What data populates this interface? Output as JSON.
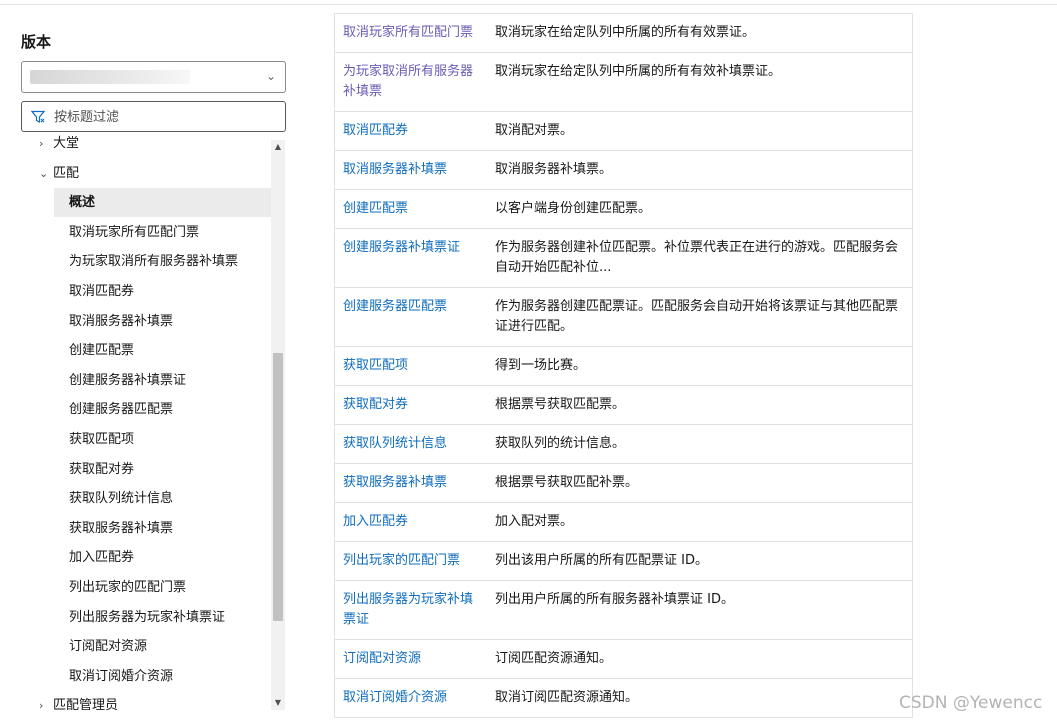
{
  "sidebar": {
    "version_heading": "版本",
    "filter_placeholder": "按标题过滤",
    "tree": [
      {
        "label": "大堂",
        "twisty": "›",
        "level": "parent",
        "selected": false
      },
      {
        "label": "匹配",
        "twisty": "⌄",
        "level": "parent",
        "selected": false
      },
      {
        "label": "概述",
        "twisty": "",
        "level": "child",
        "selected": true
      },
      {
        "label": "取消玩家所有匹配门票",
        "twisty": "",
        "level": "child",
        "selected": false
      },
      {
        "label": "为玩家取消所有服务器补填票",
        "twisty": "",
        "level": "child",
        "selected": false
      },
      {
        "label": "取消匹配券",
        "twisty": "",
        "level": "child",
        "selected": false
      },
      {
        "label": "取消服务器补填票",
        "twisty": "",
        "level": "child",
        "selected": false
      },
      {
        "label": "创建匹配票",
        "twisty": "",
        "level": "child",
        "selected": false
      },
      {
        "label": "创建服务器补填票证",
        "twisty": "",
        "level": "child",
        "selected": false
      },
      {
        "label": "创建服务器匹配票",
        "twisty": "",
        "level": "child",
        "selected": false
      },
      {
        "label": "获取匹配项",
        "twisty": "",
        "level": "child",
        "selected": false
      },
      {
        "label": "获取配对券",
        "twisty": "",
        "level": "child",
        "selected": false
      },
      {
        "label": "获取队列统计信息",
        "twisty": "",
        "level": "child",
        "selected": false
      },
      {
        "label": "获取服务器补填票",
        "twisty": "",
        "level": "child",
        "selected": false
      },
      {
        "label": "加入匹配券",
        "twisty": "",
        "level": "child",
        "selected": false
      },
      {
        "label": "列出玩家的匹配门票",
        "twisty": "",
        "level": "child",
        "selected": false
      },
      {
        "label": "列出服务器为玩家补填票证",
        "twisty": "",
        "level": "child",
        "selected": false
      },
      {
        "label": "订阅配对资源",
        "twisty": "",
        "level": "child",
        "selected": false
      },
      {
        "label": "取消订阅婚介资源",
        "twisty": "",
        "level": "child",
        "selected": false
      },
      {
        "label": "匹配管理员",
        "twisty": "›",
        "level": "parent",
        "selected": false
      }
    ],
    "icons": {
      "filter": "filter-icon",
      "dropdown": "chevron-down-icon"
    }
  },
  "table": {
    "rows": [
      {
        "name": "取消玩家所有匹配门票",
        "desc": "取消玩家在给定队列中所属的所有有效票证。",
        "visited": true
      },
      {
        "name": "为玩家取消所有服务器补填票",
        "desc": "取消玩家在给定队列中所属的所有有效补填票证。",
        "visited": true
      },
      {
        "name": "取消匹配券",
        "desc": "取消配对票。",
        "visited": false
      },
      {
        "name": "取消服务器补填票",
        "desc": "取消服务器补填票。",
        "visited": false
      },
      {
        "name": "创建匹配票",
        "desc": "以客户端身份创建匹配票。",
        "visited": false
      },
      {
        "name": "创建服务器补填票证",
        "desc": "作为服务器创建补位匹配票。补位票代表正在进行的游戏。匹配服务会自动开始匹配补位...",
        "visited": false
      },
      {
        "name": "创建服务器匹配票",
        "desc": "作为服务器创建匹配票证。匹配服务会自动开始将该票证与其他匹配票证进行匹配。",
        "visited": false
      },
      {
        "name": "获取匹配项",
        "desc": "得到一场比赛。",
        "visited": false
      },
      {
        "name": "获取配对券",
        "desc": "根据票号获取匹配票。",
        "visited": false
      },
      {
        "name": "获取队列统计信息",
        "desc": "获取队列的统计信息。",
        "visited": false
      },
      {
        "name": "获取服务器补填票",
        "desc": "根据票号获取匹配补票。",
        "visited": false
      },
      {
        "name": "加入匹配券",
        "desc": "加入配对票。",
        "visited": false
      },
      {
        "name": "列出玩家的匹配门票",
        "desc": "列出该用户所属的所有匹配票证 ID。",
        "visited": false
      },
      {
        "name": "列出服务器为玩家补填票证",
        "desc": "列出用户所属的所有服务器补填票证 ID。",
        "visited": false
      },
      {
        "name": "订阅配对资源",
        "desc": "订阅匹配资源通知。",
        "visited": false
      },
      {
        "name": "取消订阅婚介资源",
        "desc": "取消订阅匹配资源通知。",
        "visited": false
      }
    ]
  },
  "watermark": "CSDN @Yewencc",
  "colors": {
    "link": "#0f6cbd",
    "visited_link": "#6b5bb3",
    "selected_bg": "#ebebeb"
  }
}
